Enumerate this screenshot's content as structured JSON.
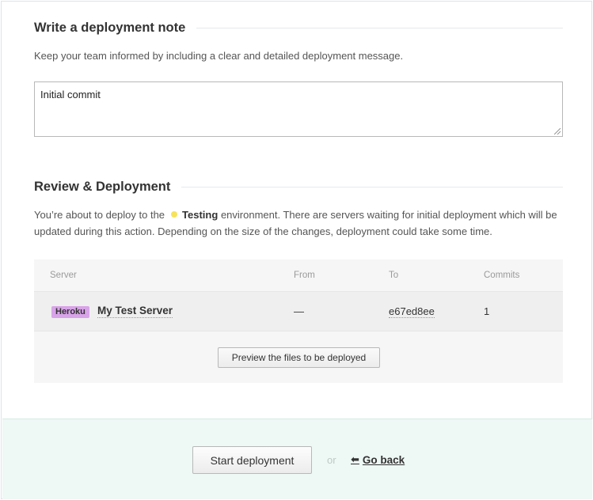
{
  "note_section": {
    "title": "Write a deployment note",
    "description": "Keep your team informed by including a clear and detailed deployment message.",
    "message_value": "Initial commit"
  },
  "review_section": {
    "title": "Review & Deployment",
    "desc_prefix": "You’re about to deploy to the",
    "environment_name": "Testing",
    "environment_color": "#f7e35b",
    "desc_suffix": "environment. There are servers waiting for initial deployment which will be updated during this action. Depending on the size of the changes, deployment could take some time."
  },
  "table": {
    "headers": [
      "Server",
      "From",
      "To",
      "Commits"
    ],
    "rows": [
      {
        "badge": "Heroku",
        "badge_color": "#d8a3e8",
        "server": "My Test Server",
        "from": "—",
        "to": "e67ed8ee",
        "commits": "1"
      }
    ],
    "preview_button": "Preview the files to be deployed"
  },
  "footer": {
    "start_button": "Start deployment",
    "or_text": "or",
    "back_icon": "arrow-back-icon",
    "back_link": "Go back",
    "background_color": "#eef8f5"
  }
}
